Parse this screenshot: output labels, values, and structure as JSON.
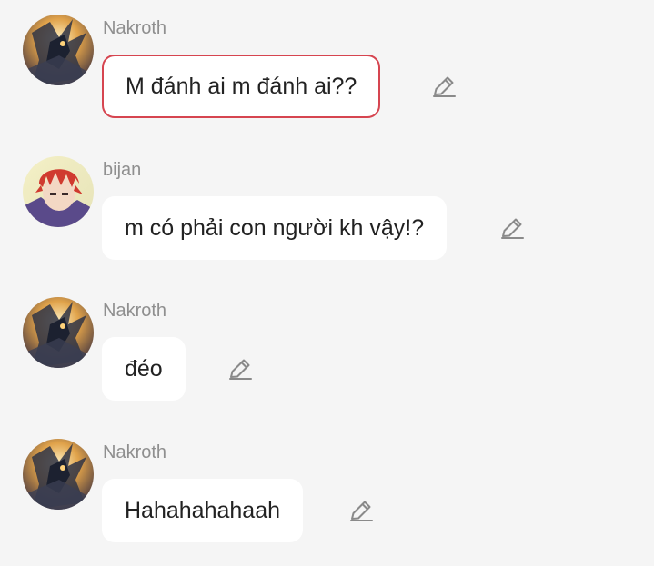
{
  "messages": [
    {
      "sender": "Nakroth",
      "text": "M đánh ai m đánh ai??",
      "selected": true,
      "avatar_icon": "nakroth-avatar-icon"
    },
    {
      "sender": "bijan",
      "text": "m có phải con người kh vậy!?",
      "selected": false,
      "avatar_icon": "red-hair-anime-avatar-icon"
    },
    {
      "sender": "Nakroth",
      "text": "đéo",
      "selected": false,
      "avatar_icon": "nakroth-avatar-icon"
    },
    {
      "sender": "Nakroth",
      "text": "Hahahahahaah",
      "selected": false,
      "avatar_icon": "nakroth-avatar-icon"
    }
  ],
  "colors": {
    "background": "#f5f5f5",
    "bubble": "#ffffff",
    "selected_border": "#d64550",
    "sender_name": "#8f8f8f",
    "edit_icon": "#8a8a8a"
  }
}
